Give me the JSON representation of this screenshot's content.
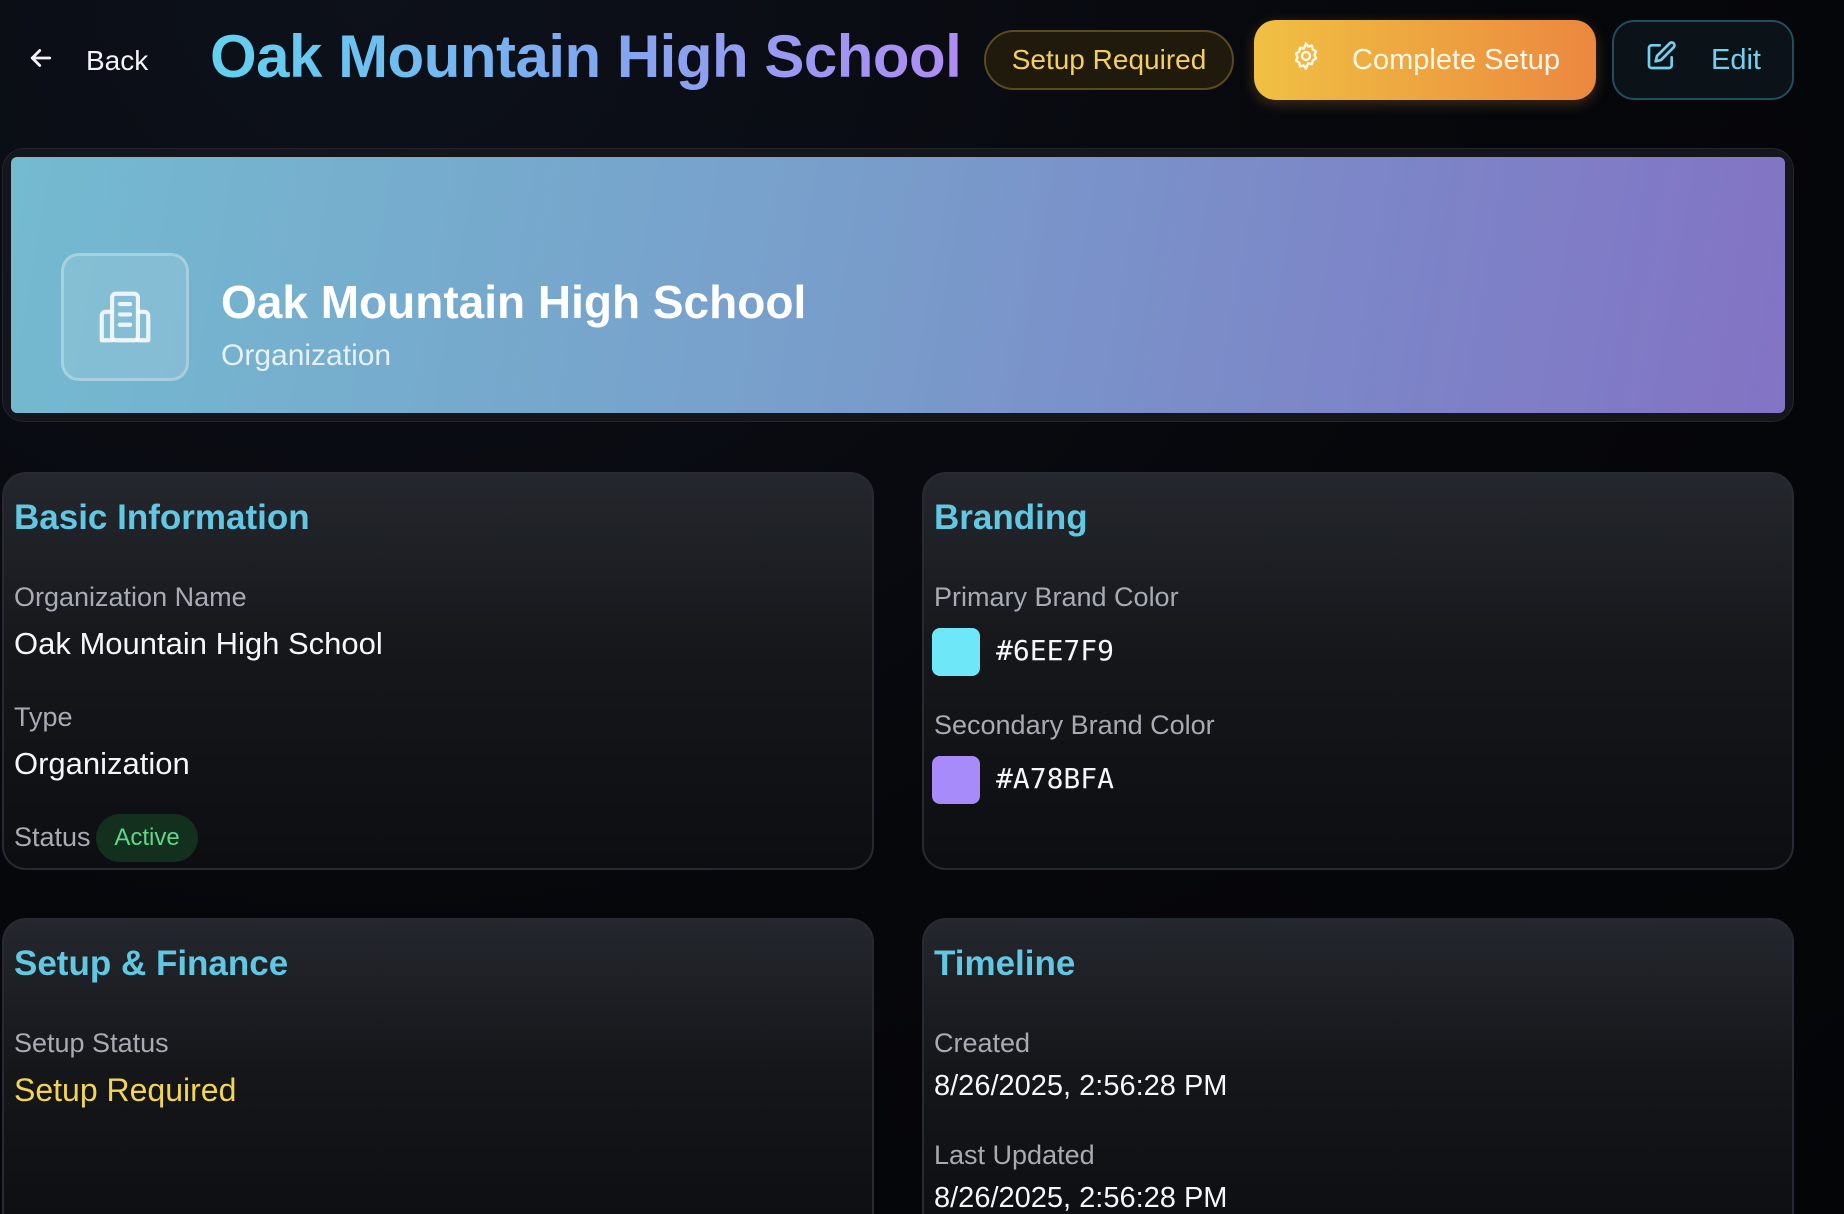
{
  "header": {
    "back_label": "Back",
    "title": "Oak Mountain High School",
    "setup_badge": "Setup Required",
    "complete_setup_label": "Complete Setup",
    "edit_label": "Edit"
  },
  "hero": {
    "name": "Oak Mountain High School",
    "type": "Organization"
  },
  "basic_info": {
    "title": "Basic Information",
    "org_name_label": "Organization Name",
    "org_name_value": "Oak Mountain High School",
    "type_label": "Type",
    "type_value": "Organization",
    "status_label": "Status",
    "status_value": "Active"
  },
  "branding": {
    "title": "Branding",
    "primary_label": "Primary Brand Color",
    "primary_hex": "#6EE7F9",
    "secondary_label": "Secondary Brand Color",
    "secondary_hex": "#A78BFA"
  },
  "setup_finance": {
    "title": "Setup & Finance",
    "setup_status_label": "Setup Status",
    "setup_status_value": "Setup Required"
  },
  "timeline": {
    "title": "Timeline",
    "created_label": "Created",
    "created_value": "8/26/2025, 2:56:28 PM",
    "updated_label": "Last Updated",
    "updated_value": "8/26/2025, 2:56:28 PM"
  },
  "colors": {
    "accent_cyan": "#62c7e3",
    "warning_yellow": "#f3d54f",
    "success_green": "#5fd68a",
    "primary_brand": "#6EE7F9",
    "secondary_brand": "#A78BFA"
  },
  "icons": {
    "back": "arrow-left-icon",
    "complete_setup": "gear-icon",
    "edit": "pencil-square-icon",
    "organization": "building-icon"
  }
}
